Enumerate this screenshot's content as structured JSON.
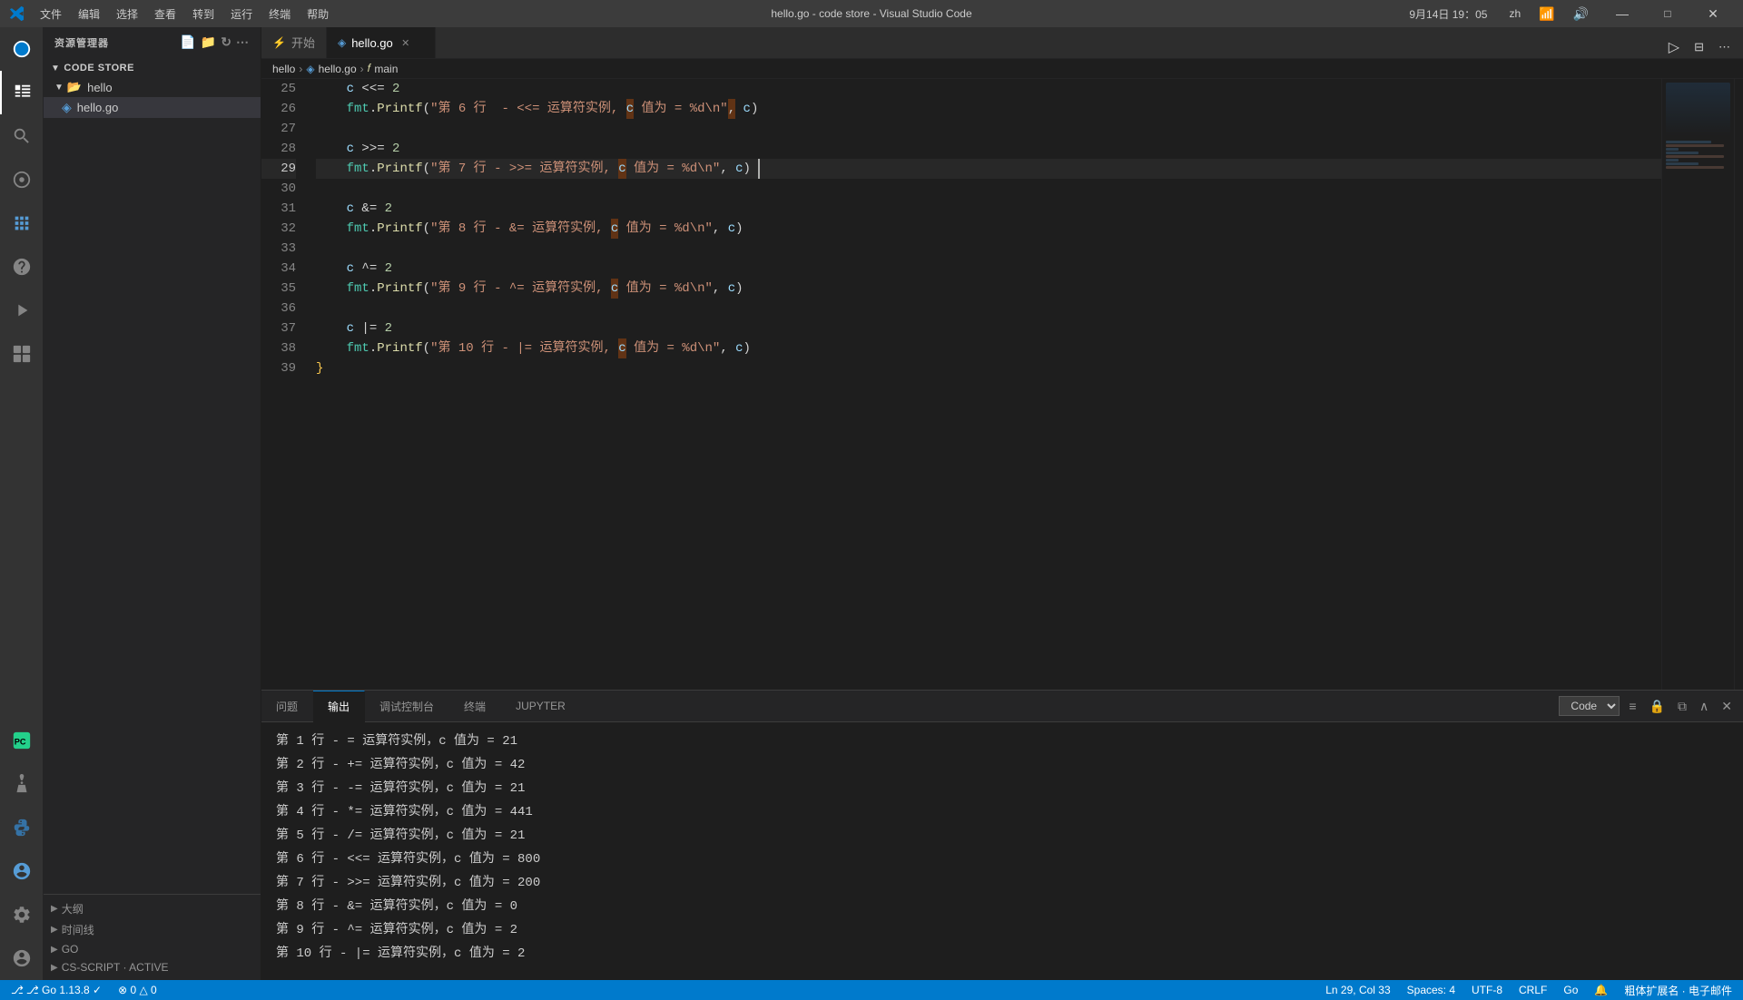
{
  "titlebar": {
    "title": "hello.go - code store - Visual Studio Code",
    "app_name": "Visual Studio Code",
    "datetime": "9月14日 19：05",
    "lang": "zh",
    "menu": [
      "文件",
      "编辑",
      "选择",
      "查看",
      "转到",
      "运行",
      "终端",
      "帮助"
    ]
  },
  "sidebar": {
    "header": "资源管理器",
    "section": "CODE STORE",
    "folder": "hello",
    "file": "hello.go",
    "bottom_sections": [
      "大纲",
      "时间线",
      "GO",
      "CS-SCRIPT · ACTIVE"
    ]
  },
  "tabs": [
    {
      "label": "开始",
      "icon": "go-icon",
      "active": false,
      "closeable": false
    },
    {
      "label": "hello.go",
      "icon": "go-file-icon",
      "active": true,
      "closeable": true
    }
  ],
  "breadcrumb": {
    "parts": [
      "hello",
      "hello.go",
      "main"
    ]
  },
  "code": {
    "lines": [
      {
        "num": 25,
        "content": "    c <<= 2",
        "tokens": [
          {
            "text": "    c ",
            "class": "plain"
          },
          {
            "text": "<<=",
            "class": "op"
          },
          {
            "text": " 2",
            "class": "num"
          }
        ]
      },
      {
        "num": 26,
        "content": "    fmt.Printf(\"第 6 行  - <<= 运算符实例, c 值为 = %d\\n\", c)",
        "active": false
      },
      {
        "num": 27,
        "content": ""
      },
      {
        "num": 28,
        "content": "    c >>= 2"
      },
      {
        "num": 29,
        "content": "    fmt.Printf(\"第 7 行 - >>= 运算符实例, c 值为 = %d\\n\", c)",
        "active": true
      },
      {
        "num": 30,
        "content": ""
      },
      {
        "num": 31,
        "content": "    c &= 2"
      },
      {
        "num": 32,
        "content": "    fmt.Printf(\"第 8 行 - &= 运算符实例, c 值为 = %d\\n\", c)"
      },
      {
        "num": 33,
        "content": ""
      },
      {
        "num": 34,
        "content": "    c ^= 2"
      },
      {
        "num": 35,
        "content": "    fmt.Printf(\"第 9 行 - ^= 运算符实例, c 值为 = %d\\n\", c)"
      },
      {
        "num": 36,
        "content": ""
      },
      {
        "num": 37,
        "content": "    c |= 2"
      },
      {
        "num": 38,
        "content": "    fmt.Printf(\"第 10 行 - |= 运算符实例, c 值为 = %d\\n\", c)"
      },
      {
        "num": 39,
        "content": "}"
      }
    ]
  },
  "panel": {
    "tabs": [
      "问题",
      "输出",
      "调试控制台",
      "终端",
      "JUPYTER"
    ],
    "active_tab": "输出",
    "output_selector": "Code",
    "output_lines": [
      "第 1 行 - =   运算符实例，c 值为 = 21",
      "第 2 行 - +=  运算符实例，c 值为 = 42",
      "第 3 行 - -=  运算符实例，c 值为 = 21",
      "第 4 行 - *=  运算符实例，c 值为 = 441",
      "第 5 行 - /=  运算符实例，c 值为 = 21",
      "第 6 行  - <<= 运算符实例，c 值为 = 800",
      "第 7 行 - >>= 运算符实例，c 值为 = 200",
      "第 8 行 - &=  运算符实例，c 值为 = 0",
      "第 9 行 - ^=  运算符实例，c 值为 = 2",
      "第 10 行 - |=  运算符实例，c 值为 = 2"
    ]
  },
  "statusbar": {
    "left": [
      "⎇ Go 1.13.8 ✓",
      "⊗ 0  △ 0"
    ],
    "right": [
      "Ln 29, Col 33",
      "Spaces: 4",
      "UTF-8",
      "CRLF",
      "Go",
      "粗体扩展名",
      "电子邮件"
    ]
  },
  "colors": {
    "accent": "#007acc",
    "background": "#1e1e1e",
    "sidebar_bg": "#252526",
    "tab_active_bg": "#1e1e1e",
    "tab_inactive_bg": "#2d2d2d",
    "keyword": "#569cd6",
    "function": "#dcdcaa",
    "string": "#ce9178",
    "number": "#b5cea8",
    "variable": "#9cdcfe"
  }
}
